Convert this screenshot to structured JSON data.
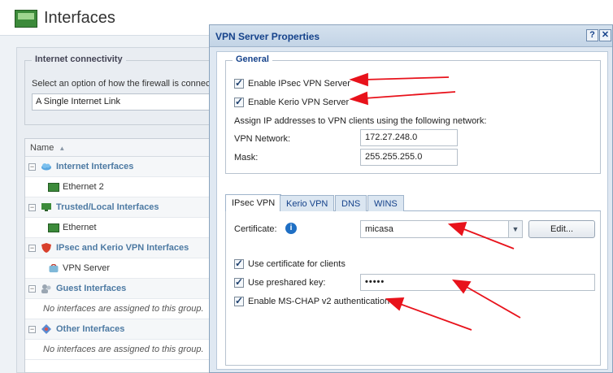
{
  "page": {
    "title": "Interfaces"
  },
  "internet_connectivity": {
    "legend": "Internet connectivity",
    "description": "Select an option of how the firewall is connect",
    "selected": "A Single Internet Link"
  },
  "grid": {
    "column_header": "Name",
    "sort_icon": "sort-asc-icon",
    "groups": [
      {
        "label": "Internet Interfaces",
        "icon": "cloud-icon",
        "child": "Ethernet 2",
        "child_icon": "network-card-icon"
      },
      {
        "label": "Trusted/Local Interfaces",
        "icon": "computer-icon",
        "child": "Ethernet",
        "child_icon": "network-card-icon"
      },
      {
        "label": "IPsec and Kerio VPN Interfaces",
        "icon": "shield-icon",
        "child": "VPN Server",
        "child_icon": "vpn-server-icon"
      },
      {
        "label": "Guest Interfaces",
        "icon": "guest-users-icon",
        "empty": "No interfaces are assigned to this group."
      },
      {
        "label": "Other Interfaces",
        "icon": "other-interfaces-icon",
        "empty": "No interfaces are assigned to this group."
      }
    ]
  },
  "dialog": {
    "title": "VPN Server Properties",
    "help_label": "?",
    "close_label": "✕",
    "general": {
      "legend": "General",
      "enable_ipsec": {
        "label": "Enable IPsec VPN Server",
        "checked": true
      },
      "enable_kerio": {
        "label": "Enable Kerio VPN Server",
        "checked": true
      },
      "assign_text": "Assign IP addresses to VPN clients using the following network:",
      "vpn_network_label": "VPN Network:",
      "vpn_network_value": "172.27.248.0",
      "mask_label": "Mask:",
      "mask_value": "255.255.255.0"
    },
    "tabs": [
      {
        "label": "IPsec VPN",
        "active": true
      },
      {
        "label": "Kerio VPN",
        "active": false
      },
      {
        "label": "DNS",
        "active": false
      },
      {
        "label": "WINS",
        "active": false
      }
    ],
    "ipsec": {
      "certificate_label": "Certificate:",
      "certificate_value": "micasa",
      "edit_label": "Edit...",
      "use_cert": {
        "label": "Use certificate for clients",
        "checked": true
      },
      "use_psk": {
        "label": "Use preshared key:",
        "checked": true
      },
      "psk_value": "•••••",
      "mschap": {
        "label": "Enable MS-CHAP v2 authentication",
        "checked": true
      }
    }
  },
  "colors": {
    "accent": "#15428b",
    "annotation_arrow": "#e8121b"
  }
}
